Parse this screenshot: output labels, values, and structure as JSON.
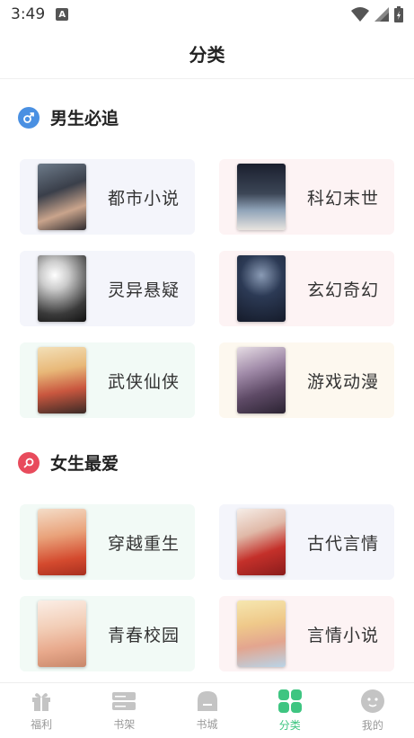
{
  "status": {
    "time": "3:49",
    "a_badge": "A"
  },
  "header": {
    "title": "分类"
  },
  "sections": [
    {
      "title": "男生必追",
      "icon": "male-icon",
      "color": "#4a90e2",
      "items": [
        {
          "label": "都市小说",
          "bg": "#f4f5fb"
        },
        {
          "label": "科幻末世",
          "bg": "#fdf3f4"
        },
        {
          "label": "灵异悬疑",
          "bg": "#f4f5fb"
        },
        {
          "label": "玄幻奇幻",
          "bg": "#fdf3f4"
        },
        {
          "label": "武侠仙侠",
          "bg": "#f2faf6"
        },
        {
          "label": "游戏动漫",
          "bg": "#fdf8ef"
        }
      ]
    },
    {
      "title": "女生最爱",
      "icon": "female-icon",
      "color": "#e84b5c",
      "items": [
        {
          "label": "穿越重生",
          "bg": "#f2faf6"
        },
        {
          "label": "古代言情",
          "bg": "#f4f5fb"
        },
        {
          "label": "青春校园",
          "bg": "#f2faf6"
        },
        {
          "label": "言情小说",
          "bg": "#fdf3f4"
        }
      ]
    }
  ],
  "tabs": [
    {
      "label": "福利",
      "icon": "gift-icon",
      "active": false
    },
    {
      "label": "书架",
      "icon": "bookshelf-icon",
      "active": false
    },
    {
      "label": "书城",
      "icon": "bookstore-icon",
      "active": false
    },
    {
      "label": "分类",
      "icon": "category-icon",
      "active": true
    },
    {
      "label": "我的",
      "icon": "profile-icon",
      "active": false
    }
  ],
  "colors": {
    "accent": "#3ec581",
    "inactive": "#bbbbbb"
  }
}
